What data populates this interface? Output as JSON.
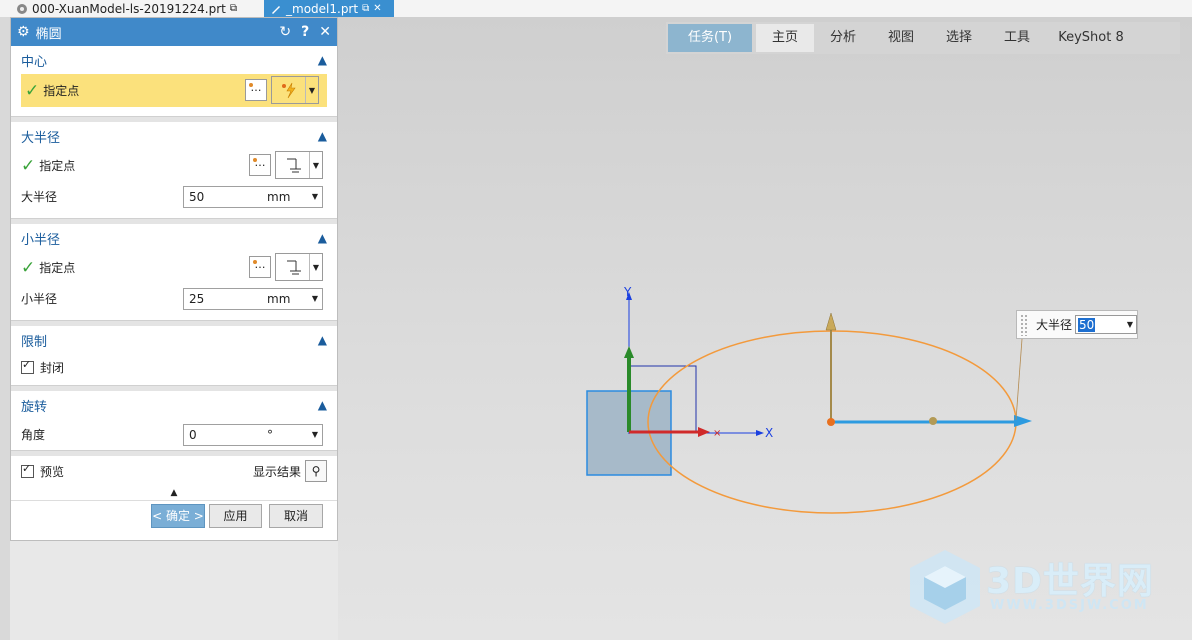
{
  "file_tabs": [
    {
      "label": "000-XuanModel-ls-20191224.prt"
    },
    {
      "label": "_model1.prt"
    }
  ],
  "ribbon": {
    "tabs": [
      "任务(T)",
      "主页",
      "分析",
      "视图",
      "选择",
      "工具",
      "KeyShot 8"
    ],
    "active": "主页"
  },
  "dialog": {
    "title": "椭圆",
    "sections": {
      "center": {
        "header": "中心",
        "point_label": "指定点"
      },
      "major": {
        "header": "大半径",
        "point_label": "指定点",
        "field_label": "大半径",
        "value": "50",
        "unit": "mm"
      },
      "minor": {
        "header": "小半径",
        "point_label": "指定点",
        "field_label": "小半径",
        "value": "25",
        "unit": "mm"
      },
      "limit": {
        "header": "限制",
        "closed_label": "封闭",
        "closed": true
      },
      "rotate": {
        "header": "旋转",
        "field_label": "角度",
        "value": "0",
        "unit": "°"
      }
    },
    "preview_label": "预览",
    "preview": true,
    "show_result_label": "显示结果",
    "buttons": {
      "ok": "< 确定 >",
      "apply": "应用",
      "cancel": "取消"
    }
  },
  "viewport": {
    "axis_labels": {
      "x": "X",
      "y": "Y"
    },
    "float_label": "大半径",
    "float_value": "50"
  },
  "watermark": {
    "brand": "3D世界网",
    "url": "WWW.3DSJW.COM"
  },
  "colors": {
    "title_bar": "#4089c9",
    "highlight_row": "#fbe17c",
    "ellipse": "#f39a3c",
    "major_axis": "#2d9be0",
    "minor_axis": "#a48a4a"
  }
}
